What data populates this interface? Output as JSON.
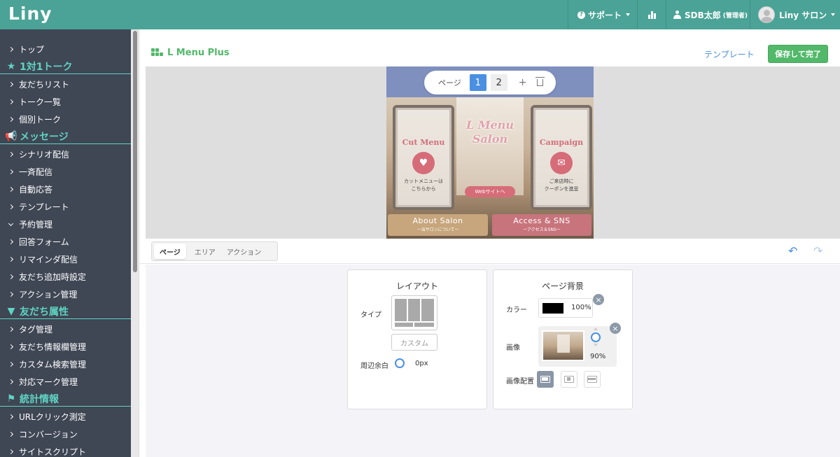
{
  "app": {
    "logo": "Liny"
  },
  "topbar": {
    "support_label": "サポート",
    "user_name": "SDB太郎",
    "user_role": "(管理者)",
    "account_name": "Liny サロン"
  },
  "sidebar": {
    "items": [
      {
        "type": "item",
        "label": "トップ"
      },
      {
        "type": "head",
        "label": "1対1トーク",
        "icon": "star-icon"
      },
      {
        "type": "item",
        "label": "友だちリスト"
      },
      {
        "type": "item",
        "label": "トーク一覧"
      },
      {
        "type": "item",
        "label": "個別トーク"
      },
      {
        "type": "head",
        "label": "メッセージ",
        "icon": "megaphone-icon"
      },
      {
        "type": "item",
        "label": "シナリオ配信"
      },
      {
        "type": "item",
        "label": "一斉配信"
      },
      {
        "type": "item",
        "label": "自動応答"
      },
      {
        "type": "item",
        "label": "テンプレート"
      },
      {
        "type": "item",
        "label": "予約管理",
        "expanded": true
      },
      {
        "type": "item",
        "label": "回答フォーム"
      },
      {
        "type": "item",
        "label": "リマインダ配信"
      },
      {
        "type": "item",
        "label": "友だち追加時設定"
      },
      {
        "type": "item",
        "label": "アクション管理"
      },
      {
        "type": "head",
        "label": "友だち属性",
        "icon": "filter-icon"
      },
      {
        "type": "item",
        "label": "タグ管理"
      },
      {
        "type": "item",
        "label": "友だち情報欄管理"
      },
      {
        "type": "item",
        "label": "カスタム検索管理"
      },
      {
        "type": "item",
        "label": "対応マーク管理"
      },
      {
        "type": "head",
        "label": "統計情報",
        "icon": "flag-icon"
      },
      {
        "type": "item",
        "label": "URLクリック測定"
      },
      {
        "type": "item",
        "label": "コンバージョン"
      },
      {
        "type": "item",
        "label": "サイトスクリプト"
      }
    ]
  },
  "editor": {
    "title": "L Menu Plus",
    "template_link": "テンプレート",
    "save_button": "保存して完了",
    "pager": {
      "label": "ページ",
      "pages": [
        "1",
        "2"
      ],
      "active": "1",
      "add": "+"
    },
    "preview": {
      "left_title": "Cut Menu",
      "left_text_1": "カットメニューは",
      "left_text_2": "こちらから",
      "center_title_1": "L Menu",
      "center_title_2": "Salon",
      "right_title": "Campaign",
      "right_text_1": "ご来店時に",
      "right_text_2": "クーポンを進呈",
      "web_button": "Webサイトへ",
      "about_title": "About Salon",
      "about_sub": "ー当サロンについてー",
      "access_title": "Access & SNS",
      "access_sub": "ーアクセス＆SNSー"
    },
    "tabs": [
      {
        "label": "ページ",
        "active": true
      },
      {
        "label": "エリア",
        "active": false
      },
      {
        "label": "アクション",
        "active": false
      }
    ],
    "layout_panel": {
      "title": "レイアウト",
      "type_label": "タイプ",
      "custom_button": "カスタム",
      "margin_label": "周辺余白",
      "margin_value": "0px"
    },
    "bg_panel": {
      "title": "ページ背景",
      "color_label": "カラー",
      "color_value": "#000000",
      "color_opacity": "100%",
      "image_label": "画像",
      "image_opacity": "90%",
      "position_label": "画像配置",
      "position_options": [
        "fit",
        "center",
        "fill"
      ],
      "position_selected": "fit"
    }
  },
  "colors": {
    "topbar": "#4aa396",
    "sidebar": "#3f4654",
    "sidebar_heading": "#5fd4c3",
    "accent_green": "#52b86a",
    "accent_blue": "#4a90e2"
  }
}
